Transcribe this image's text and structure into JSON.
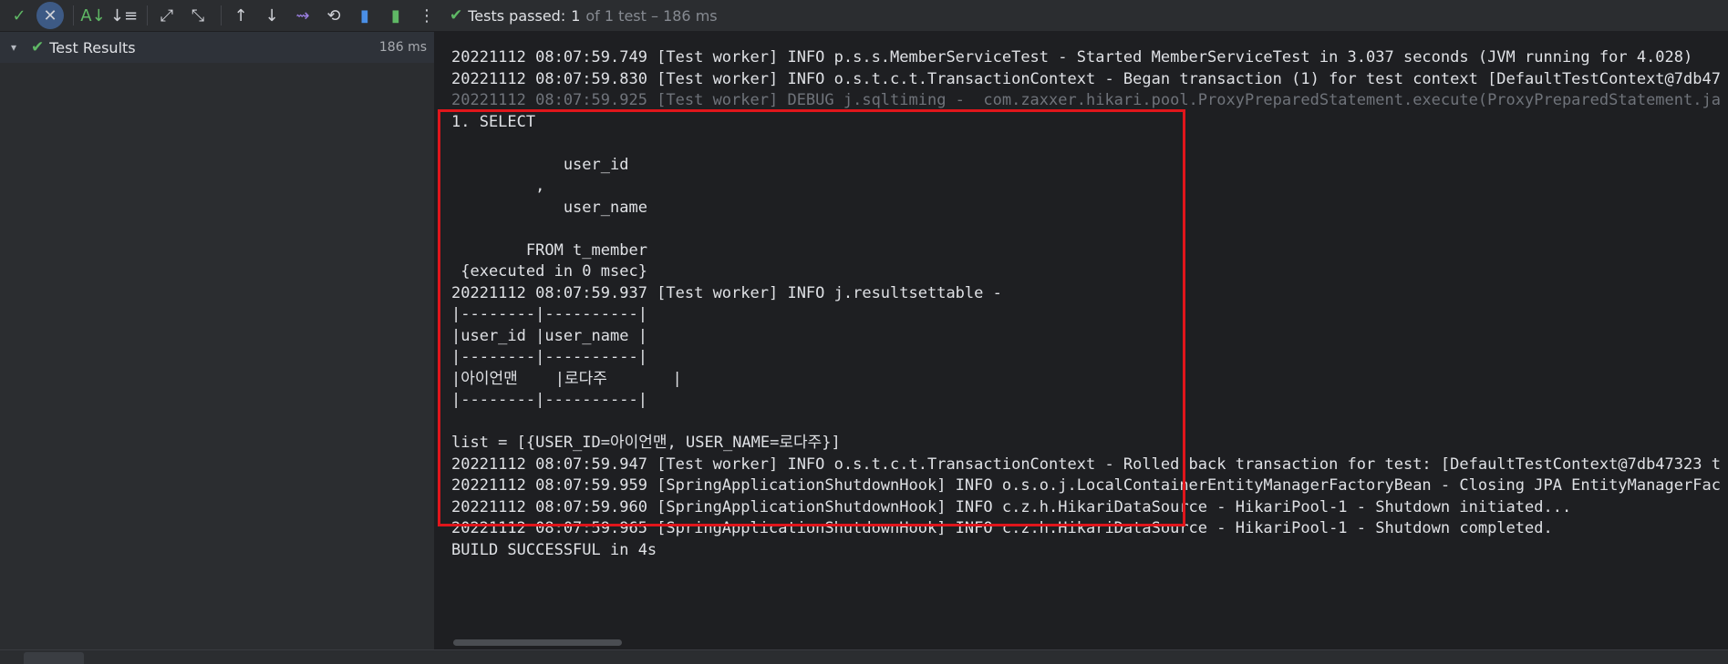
{
  "toolbar": {
    "buttons": [
      {
        "name": "show-passed-icon",
        "glyph": "✓"
      },
      {
        "name": "show-ignored-icon",
        "glyph": "✕"
      },
      {
        "name": "sort-alpha-icon",
        "glyph": "A↓"
      },
      {
        "name": "sort-duration-icon",
        "glyph": "↓≡"
      },
      {
        "name": "expand-all-icon",
        "glyph": "⤢"
      },
      {
        "name": "collapse-all-icon",
        "glyph": "⤡"
      },
      {
        "name": "prev-failed-icon",
        "glyph": "↑"
      },
      {
        "name": "next-failed-icon",
        "glyph": "↓"
      },
      {
        "name": "import-tests-icon",
        "glyph": "⇝"
      },
      {
        "name": "history-icon",
        "glyph": "⟲"
      },
      {
        "name": "export-icon",
        "glyph": "▮"
      },
      {
        "name": "import-results-icon",
        "glyph": "▮"
      },
      {
        "name": "more-options-icon",
        "glyph": "⋮"
      }
    ],
    "status_prefix": "Tests passed:",
    "status_count": "1",
    "status_rest": "of 1 test – 186 ms"
  },
  "tree": {
    "root_label": "Test Results",
    "root_duration": "186 ms"
  },
  "console": {
    "lines": [
      {
        "text": "20221112 08:07:59.749 [Test worker] INFO p.s.s.MemberServiceTest - Started MemberServiceTest in 3.037 seconds (JVM running for 4.028)",
        "dim": false
      },
      {
        "text": "20221112 08:07:59.830 [Test worker] INFO o.s.t.c.t.TransactionContext - Began transaction (1) for test context [DefaultTestContext@7db47",
        "dim": false
      },
      {
        "text": "20221112 08:07:59.925 [Test worker] DEBUG j.sqltiming -  com.zaxxer.hikari.pool.ProxyPreparedStatement.execute(ProxyPreparedStatement.ja",
        "dim": true
      },
      {
        "text": "1. SELECT",
        "dim": false
      },
      {
        "text": "",
        "dim": false
      },
      {
        "text": "            user_id",
        "dim": false
      },
      {
        "text": "         ,",
        "dim": false
      },
      {
        "text": "            user_name",
        "dim": false
      },
      {
        "text": "",
        "dim": false
      },
      {
        "text": "        FROM t_member",
        "dim": false
      },
      {
        "text": " {executed in 0 msec}",
        "dim": false
      },
      {
        "text": "20221112 08:07:59.937 [Test worker] INFO j.resultsettable -",
        "dim": false
      },
      {
        "text": "|--------|----------|",
        "dim": false
      },
      {
        "text": "|user_id |user_name |",
        "dim": false
      },
      {
        "text": "|--------|----------|",
        "dim": false
      },
      {
        "text": "|아이언맨    |로다주       |",
        "dim": false
      },
      {
        "text": "|--------|----------|",
        "dim": false
      },
      {
        "text": "",
        "dim": false
      },
      {
        "text": "list = [{USER_ID=아이언맨, USER_NAME=로다주}]",
        "dim": false
      },
      {
        "text": "20221112 08:07:59.947 [Test worker] INFO o.s.t.c.t.TransactionContext - Rolled back transaction for test: [DefaultTestContext@7db47323 t",
        "dim": false
      },
      {
        "text": "20221112 08:07:59.959 [SpringApplicationShutdownHook] INFO o.s.o.j.LocalContainerEntityManagerFactoryBean - Closing JPA EntityManagerFac",
        "dim": false
      },
      {
        "text": "20221112 08:07:59.960 [SpringApplicationShutdownHook] INFO c.z.h.HikariDataSource - HikariPool-1 - Shutdown initiated...",
        "dim": false
      },
      {
        "text": "20221112 08:07:59.965 [SpringApplicationShutdownHook] INFO c.z.h.HikariDataSource - HikariPool-1 - Shutdown completed.",
        "dim": false
      },
      {
        "text": "BUILD SUCCESSFUL in 4s",
        "dim": false
      }
    ]
  },
  "colors": {
    "accent_passed": "#5fb865",
    "highlight_box": "#e0161b",
    "background": "#1e1f22",
    "panel": "#2b2d30"
  }
}
